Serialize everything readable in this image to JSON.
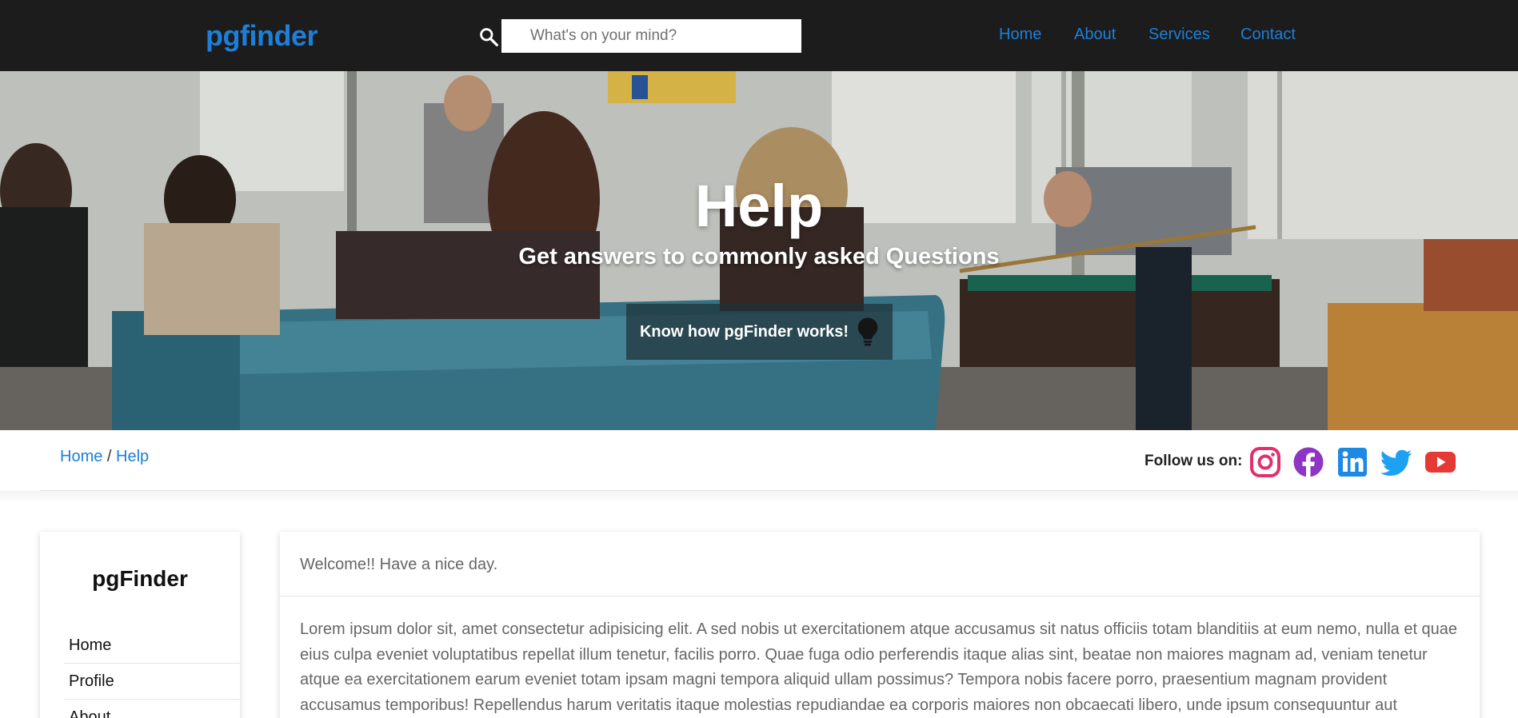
{
  "nav": {
    "brand": "pgfinder",
    "search_placeholder": "What's on your mind?",
    "links": [
      "Home",
      "About",
      "Services",
      "Contact"
    ]
  },
  "hero": {
    "title": "Help",
    "subtitle": "Get answers to commonly asked Questions",
    "button_label": "Know how pgFinder works!",
    "button_icon": "lightbulb-icon"
  },
  "breadcrumb": {
    "home": "Home",
    "separator": "/",
    "current": "Help"
  },
  "social": {
    "label": "Follow us on:",
    "icons": [
      "instagram-icon",
      "facebook-icon",
      "linkedin-icon",
      "twitter-icon",
      "youtube-icon"
    ]
  },
  "sidebar": {
    "title": "pgFinder",
    "items": [
      "Home",
      "Profile",
      "About"
    ]
  },
  "main": {
    "greeting": "Welcome!! Have a nice day.",
    "body": "Lorem ipsum dolor sit, amet consectetur adipisicing elit. A sed nobis ut exercitationem atque accusamus sit natus officiis totam blanditiis at eum nemo, nulla et quae eius culpa eveniet voluptatibus repellat illum tenetur, facilis porro. Quae fuga odio perferendis itaque alias sint, beatae non maiores magnam ad, veniam tenetur atque ea exercitationem earum eveniet totam ipsam magni tempora aliquid ullam possimus? Tempora nobis facere porro, praesentium magnam provident accusamus temporibus! Repellendus harum veritatis itaque molestias repudiandae ea corporis maiores non obcaecati libero, unde ipsum consequuntur aut"
  },
  "colors": {
    "nav_bg": "#1c1c1c",
    "accent": "#1e7fd8",
    "instagram": "#e1306c",
    "facebook": "#8e35c4",
    "linkedin": "#1e88e5",
    "twitter": "#1da1f2",
    "youtube": "#e53935"
  }
}
